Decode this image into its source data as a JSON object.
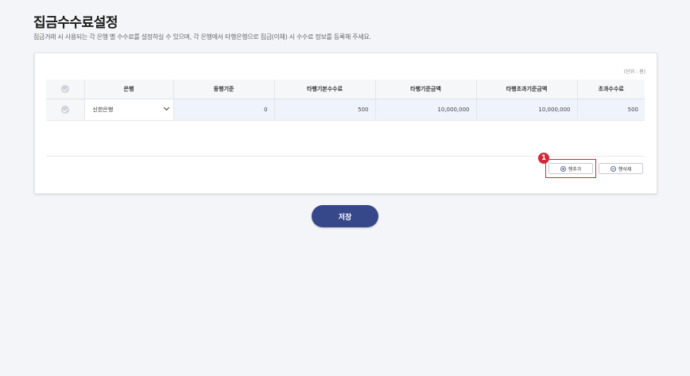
{
  "page": {
    "title": "집금수수료설정",
    "description": "집금거래 시 사용되는 각 은행 별 수수료를 설정하실 수 있으며, 각 은행에서 타행은행으로 집금(이체) 시 수수료 정보를 등록해 주세요."
  },
  "table": {
    "unit": "(단위 : 원)",
    "headers": [
      "은행",
      "동행기준",
      "타행기본수수료",
      "타행기준금액",
      "타행초과기준금액",
      "초과수수료"
    ],
    "rows": [
      {
        "bank": "신한은행",
        "same_bank": "0",
        "base_fee": "500",
        "base_amount": "10,000,000",
        "excess_base_amount": "10,000,000",
        "excess_fee": "500"
      }
    ]
  },
  "actions": {
    "add_row": "행추가",
    "delete_row": "행삭제",
    "save": "저장",
    "step_badge": "1"
  },
  "colors": {
    "accent": "#36478a",
    "highlight": "#d6263a",
    "cell_fill": "#eff3fb"
  }
}
